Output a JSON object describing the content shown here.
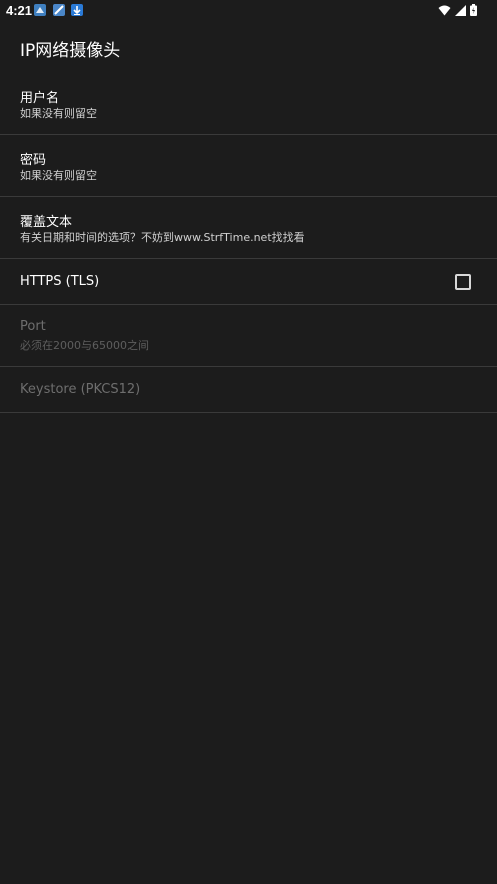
{
  "status_bar": {
    "time": "4:21",
    "notification_icons": [
      "app-icon",
      "app-icon",
      "download-icon"
    ],
    "right_icons": [
      "wifi-icon",
      "signal-icon",
      "battery-icon"
    ]
  },
  "app_bar": {
    "title": "IP网络摄像头"
  },
  "preferences": [
    {
      "title": "用户名",
      "summary": "如果没有则留空"
    },
    {
      "title": "密码",
      "summary": "如果没有则留空"
    },
    {
      "title": "覆盖文本",
      "summary": "有关日期和时间的选项？不妨到www.StrfTime.net找找看"
    },
    {
      "title": "HTTPS (TLS)",
      "checked": false
    },
    {
      "title": "Port",
      "summary": "必须在2000与65000之间"
    },
    {
      "title": "Keystore (PKCS12)"
    }
  ],
  "colors": {
    "background": "#1c1c1c",
    "divider": "#3a3a3a",
    "disabled_text": "#6e6e6e"
  }
}
